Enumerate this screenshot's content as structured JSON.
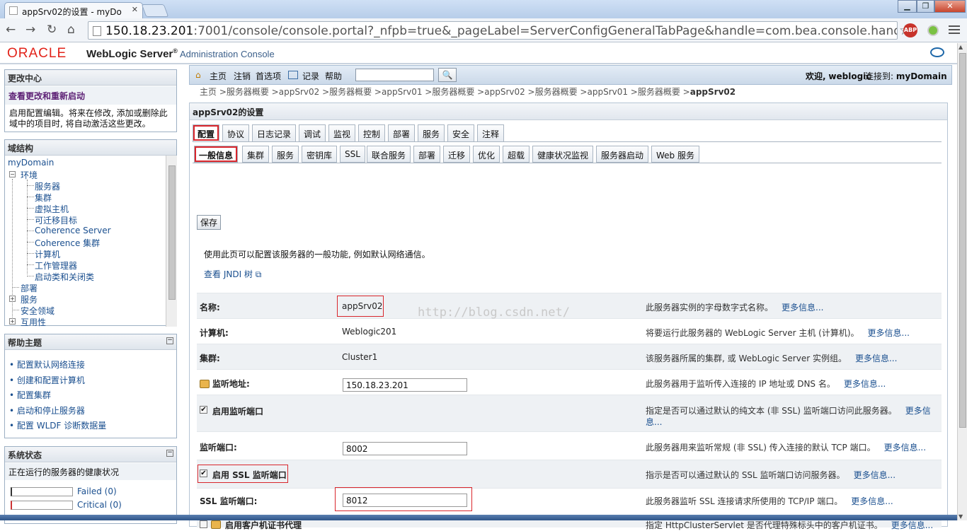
{
  "browser": {
    "tab_title": "appSrv02的设置 - myDo",
    "url_host": "150.18.23.201",
    "url_rest": ":7001/console/console.portal?_nfpb=true&_pageLabel=ServerConfigGeneralTabPage&handle=com.bea.console.handles.JMXHan",
    "abp": "ABP"
  },
  "brand": {
    "oracle": "ORACLE",
    "product": "WebLogic Server",
    "reg": "®",
    "admin": "Administration Console"
  },
  "change_center": {
    "title": "更改中心",
    "link": "查看更改和重新启动",
    "text1": "启用配置编辑。将来在修改, 添加或删除此",
    "text2": "域中的项目时, 将自动激活这些更改。"
  },
  "domain_structure": {
    "title": "域结构",
    "root": "myDomain",
    "env": "环境",
    "env_children": [
      "服务器",
      "集群",
      "虚拟主机",
      "可迁移目标",
      "Coherence Server",
      "Coherence 集群",
      "计算机",
      "工作管理器",
      "启动类和关闭类"
    ],
    "others": [
      "部署",
      "服务",
      "安全领域",
      "互用性"
    ]
  },
  "help": {
    "title": "帮助主题",
    "items": [
      "配置默认网络连接",
      "创建和配置计算机",
      "配置集群",
      "启动和停止服务器",
      "配置 WLDF 诊断数据量"
    ]
  },
  "system_status": {
    "title": "系统状态",
    "subtitle": "正在运行的服务器的健康状况",
    "failed": "Failed (0)",
    "critical": "Critical (0)"
  },
  "topbar": {
    "home": "主页",
    "logout": "注销",
    "prefs": "首选项",
    "record": "记录",
    "help": "帮助",
    "welcome": "欢迎,",
    "user": "weblogic",
    "connected": "连接到:",
    "domain": "myDomain"
  },
  "breadcrumb": {
    "path": "主页 >服务器概要 >appSrv02 >服务器概要 >appSrv01 >服务器概要 >appSrv02 >服务器概要 >appSrv01 >服务器概要 >",
    "current": "appSrv02"
  },
  "main": {
    "title": "appSrv02的设置",
    "tabs": [
      "配置",
      "协议",
      "日志记录",
      "调试",
      "监视",
      "控制",
      "部署",
      "服务",
      "安全",
      "注释"
    ],
    "subtabs": [
      "一般信息",
      "集群",
      "服务",
      "密钥库",
      "SSL",
      "联合服务",
      "部署",
      "迁移",
      "优化",
      "超载",
      "健康状况监视",
      "服务器启动",
      "Web 服务"
    ],
    "save": "保存",
    "intro": "使用此页可以配置该服务器的一般功能, 例如默认网络通信。",
    "jndi": "查看 JNDI 树",
    "fields": {
      "name_label": "名称:",
      "name_val": "appSrv02",
      "name_desc": "此服务器实例的字母数字式名称。",
      "machine_label": "计算机:",
      "machine_val": "Weblogic201",
      "machine_desc": "将要运行此服务器的 WebLogic Server 主机 (计算机)。",
      "cluster_label": "集群:",
      "cluster_val": "Cluster1",
      "cluster_desc": "该服务器所属的集群, 或 WebLogic Server 实例组。",
      "listen_addr_label": "监听地址:",
      "listen_addr_val": "150.18.23.201",
      "listen_addr_desc": "此服务器用于监听传入连接的 IP 地址或 DNS 名。",
      "listen_port_enabled_label": "启用监听端口",
      "listen_port_enabled_desc": "指定是否可以通过默认的纯文本 (非 SSL) 监听端口访问此服务器。",
      "listen_port_enabled_more1": "更多信",
      "listen_port_enabled_more2": "息...",
      "listen_port_label": "监听端口:",
      "listen_port_val": "8002",
      "listen_port_desc": "此服务器用来监听常规 (非 SSL) 传入连接的默认 TCP 端口。",
      "ssl_enabled_label": "启用 SSL 监听端口",
      "ssl_enabled_desc": "指示是否可以通过默认的 SSL 监听端口访问服务器。",
      "ssl_port_label": "SSL 监听端口:",
      "ssl_port_val": "8012",
      "ssl_port_desc": "此服务器监听 SSL 连接请求所使用的 TCP/IP 端口。",
      "client_cert_label": "启用客户机证书代理",
      "client_cert_desc": "指定 HttpClusterServlet 是否代理特殊标头中的客户机证书。"
    },
    "more": "更多信息...",
    "watermark": "http://blog.csdn.net/"
  }
}
